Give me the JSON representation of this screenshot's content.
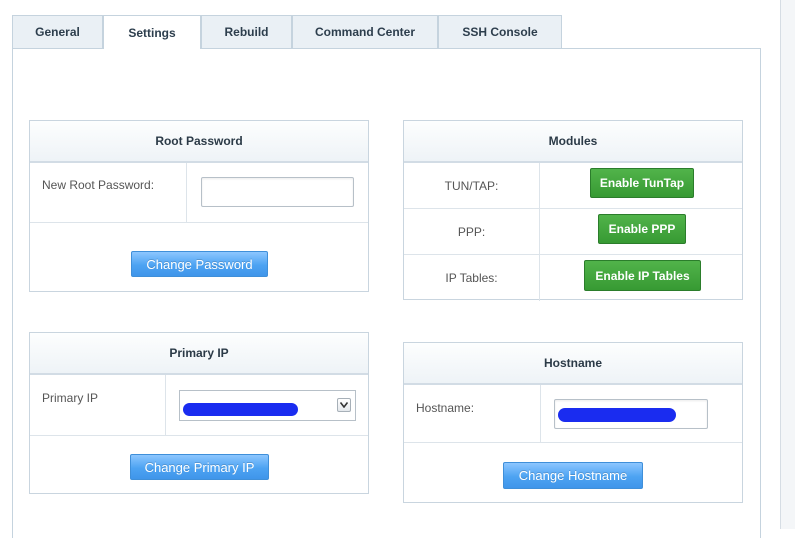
{
  "tabs": [
    {
      "label": "General",
      "active": false
    },
    {
      "label": "Settings",
      "active": true
    },
    {
      "label": "Rebuild",
      "active": false
    },
    {
      "label": "Command Center",
      "active": false
    },
    {
      "label": "SSH Console",
      "active": false
    }
  ],
  "root_password": {
    "title": "Root Password",
    "field_label": "New Root Password:",
    "field_value": "",
    "button": "Change Password"
  },
  "modules": {
    "title": "Modules",
    "rows": [
      {
        "label": "TUN/TAP:",
        "button": "Enable TunTap"
      },
      {
        "label": "PPP:",
        "button": "Enable PPP"
      },
      {
        "label": "IP Tables:",
        "button": "Enable IP Tables"
      }
    ]
  },
  "primary_ip": {
    "title": "Primary IP",
    "field_label": "Primary IP",
    "button": "Change Primary IP"
  },
  "hostname": {
    "title": "Hostname",
    "field_label": "Hostname:",
    "button": "Change Hostname"
  },
  "colors": {
    "blue_button": "#4da3f2",
    "green_button": "#379a33",
    "redaction": "#1a2cf0"
  }
}
